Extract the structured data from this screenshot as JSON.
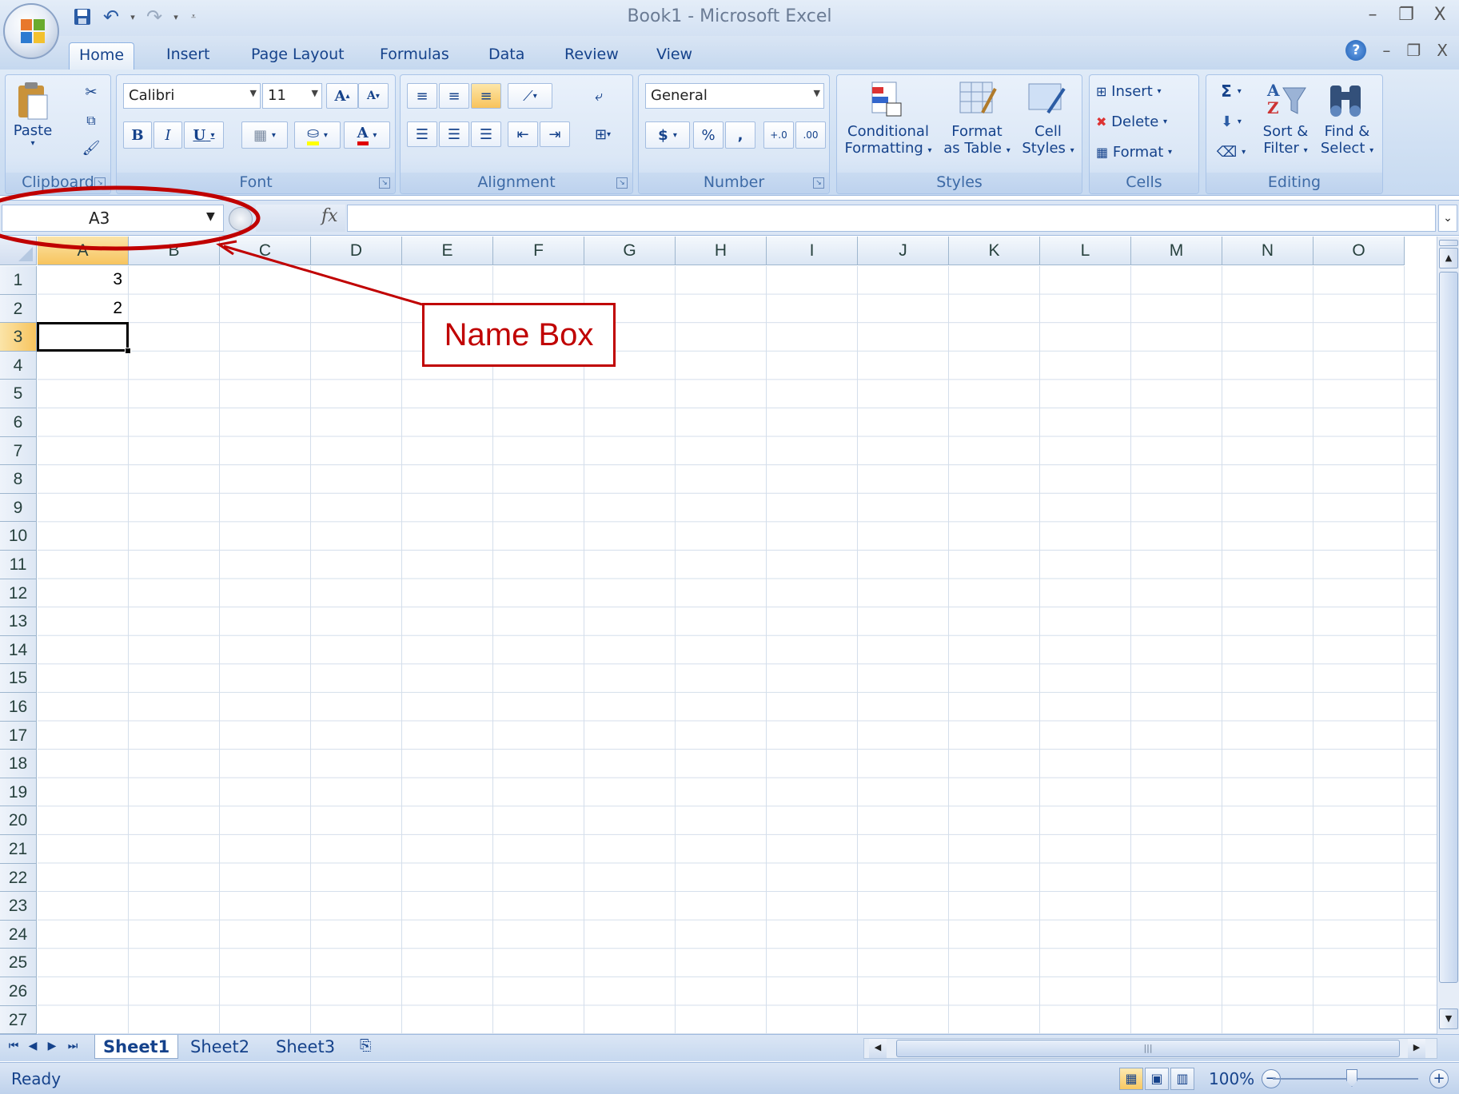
{
  "window": {
    "title": "Book1 - Microsoft Excel"
  },
  "tabs": [
    "Home",
    "Insert",
    "Page Layout",
    "Formulas",
    "Data",
    "Review",
    "View"
  ],
  "ribbon": {
    "clipboard": {
      "label": "Clipboard",
      "paste": "Paste"
    },
    "font": {
      "label": "Font",
      "name": "Calibri",
      "size": "11",
      "bold": "B",
      "italic": "I",
      "underline": "U",
      "font_color": "A",
      "grow": "A",
      "shrink": "A"
    },
    "alignment": {
      "label": "Alignment"
    },
    "number": {
      "label": "Number",
      "format": "General",
      "currency": "$",
      "percent": "%",
      "comma": ","
    },
    "styles": {
      "label": "Styles",
      "conditional_1": "Conditional",
      "conditional_2": "Formatting",
      "format_table_1": "Format",
      "format_table_2": "as Table",
      "cell_styles_1": "Cell",
      "cell_styles_2": "Styles"
    },
    "cells": {
      "label": "Cells",
      "insert": "Insert",
      "delete": "Delete",
      "format": "Format"
    },
    "editing": {
      "label": "Editing",
      "sort_1": "Sort &",
      "sort_2": "Filter",
      "find_1": "Find &",
      "find_2": "Select",
      "sum": "Σ"
    }
  },
  "formula_bar": {
    "name_box": "A3",
    "fx": "fx",
    "formula": ""
  },
  "grid": {
    "columns": [
      "A",
      "B",
      "C",
      "D",
      "E",
      "F",
      "G",
      "H",
      "I",
      "J",
      "K",
      "L",
      "M",
      "N",
      "O"
    ],
    "rows": [
      "1",
      "2",
      "3",
      "4",
      "5",
      "6",
      "7",
      "8",
      "9",
      "10",
      "11",
      "12",
      "13",
      "14",
      "15",
      "16",
      "17",
      "18",
      "19",
      "20",
      "21",
      "22",
      "23",
      "24",
      "25",
      "26",
      "27"
    ],
    "selected_col": "A",
    "selected_row": "3",
    "cells": [
      {
        "ref": "A1",
        "value": "3"
      },
      {
        "ref": "A2",
        "value": "2"
      }
    ]
  },
  "sheets": [
    "Sheet1",
    "Sheet2",
    "Sheet3"
  ],
  "active_sheet": "Sheet1",
  "status": {
    "text": "Ready",
    "zoom": "100%"
  },
  "annotation": {
    "label": "Name Box",
    "color": "#c00000"
  }
}
